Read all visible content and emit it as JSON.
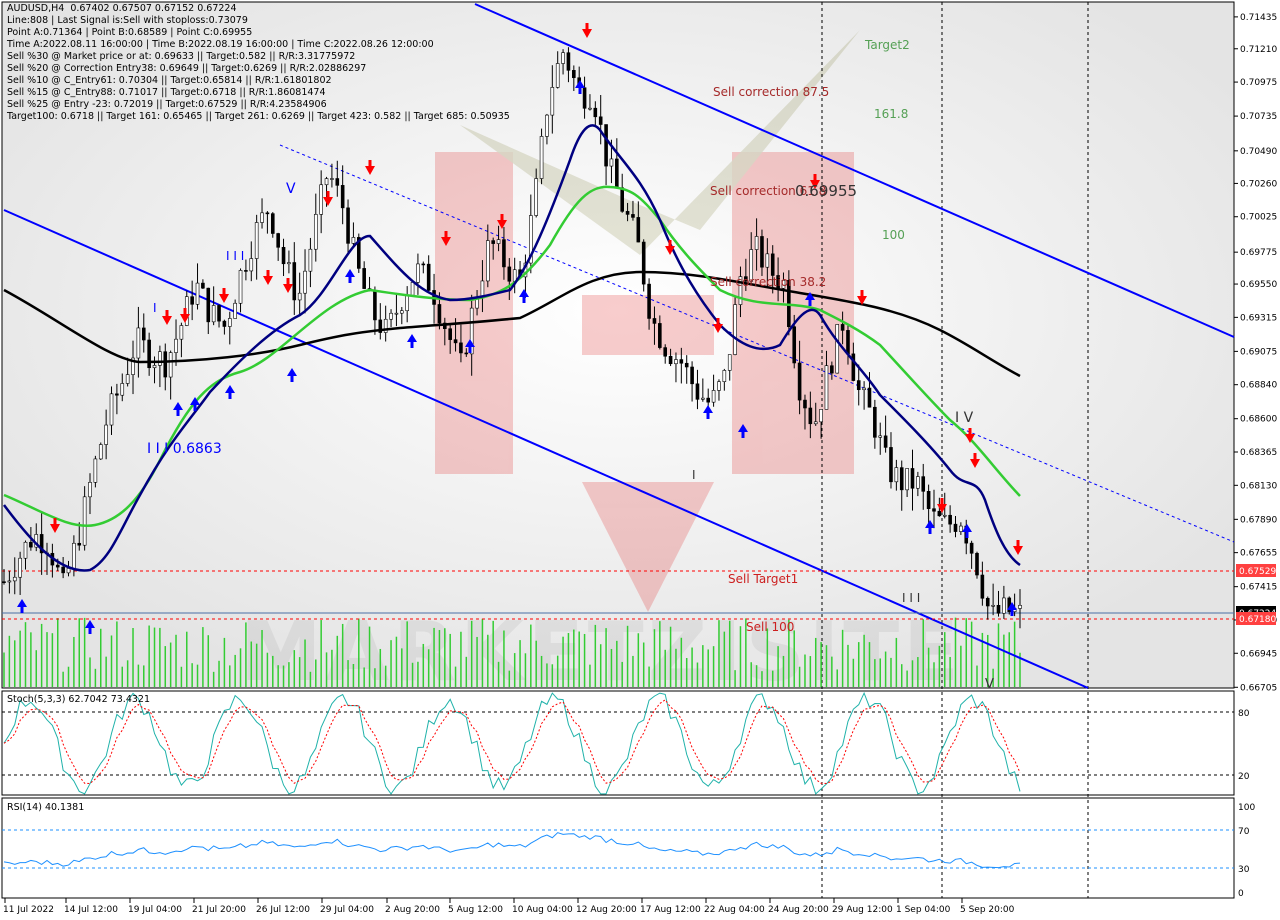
{
  "info_lines": [
    "AUDUSD,H4  0.67402 0.67507 0.67152 0.67224",
    "Line:808 | Last Signal is:Sell with stoploss:0.73079",
    "Point A:0.71364 | Point B:0.68589 | Point C:0.69955",
    "Time A:2022.08.11 16:00:00 | Time B:2022.08.19 16:00:00 | Time C:2022.08.26 12:00:00",
    "Sell %30 @ Market price or at: 0.69633 || Target:0.582 || R/R:3.31775972",
    "Sell %20 @ Correction Entry38: 0.69649 || Target:0.6269 || R/R:2.02886297",
    "Sell %10 @ C_Entry61: 0.70304 || Target:0.65814 || R/R:1.61801802",
    "Sell %15 @ C_Entry88: 0.71017 || Target:0.6718 || R/R:1.86081474",
    "Sell %25 @ Entry -23: 0.72019 || Target:0.67529 || R/R:4.23584906",
    "Target100: 0.6718 || Target 161: 0.65465 || Target 261: 0.6269 || Target 423: 0.582 || Target 685: 0.50935"
  ],
  "annotations": {
    "target2": "Target2",
    "fib_161": "161.8",
    "fib_100": "100",
    "sell_corr_875": "Sell correction 87.5",
    "sell_corr_618": "Sell correction 61.8",
    "point_c_value": "0.69955",
    "sell_corr_382": "Sell correction 38.2",
    "sell_target1": "Sell Target1",
    "sell_100": "Sell 100",
    "wave_v_top": "V",
    "wave_iii": "I I I",
    "wave_i": "I",
    "wave_iii_value": "I I I 0.6863",
    "wave_iv": "I V",
    "wave_i_low": "I",
    "wave_iii_low": "I I I",
    "wave_v_low": "V"
  },
  "stoch_label": "Stoch(5,3,3) 62.7042 73.4321",
  "rsi_label": "RSI(14) 40.1381",
  "current_price": "0.67224",
  "colors": {
    "channel": "#0000ff",
    "ma_black": "#000000",
    "ma_green": "#33cc33",
    "ma_navy": "#000080",
    "sell_arrow": "#ff0000",
    "buy_arrow": "#0000ff",
    "volume": "#33cc33",
    "target_line": "#ff0000",
    "stoch_main": "#20b2aa",
    "stoch_signal": "#ff0000",
    "rsi": "#1e90ff"
  },
  "chart_data": {
    "type": "candlestick",
    "symbol": "AUDUSD,H4",
    "ohlc_last": {
      "open": 0.67402,
      "high": 0.67507,
      "low": 0.67152,
      "close": 0.67224
    },
    "price_axis": {
      "ylim": [
        0.667,
        0.7154
      ],
      "ticks": [
        "0.71435",
        "0.71210",
        "0.70975",
        "0.70735",
        "0.70490",
        "0.70260",
        "0.70025",
        "0.69775",
        "0.69550",
        "0.69315",
        "0.69075",
        "0.68840",
        "0.68600",
        "0.68365",
        "0.68130",
        "0.67890",
        "0.67655",
        "0.67415",
        "0.67180",
        "0.66945",
        "0.66705"
      ]
    },
    "time_axis": {
      "ticks": [
        "11 Jul 2022",
        "14 Jul 12:00",
        "19 Jul 04:00",
        "21 Jul 20:00",
        "26 Jul 12:00",
        "29 Jul 04:00",
        "2 Aug 20:00",
        "5 Aug 12:00",
        "10 Aug 04:00",
        "12 Aug 20:00",
        "17 Aug 12:00",
        "22 Aug 04:00",
        "24 Aug 20:00",
        "29 Aug 12:00",
        "1 Sep 04:00",
        "5 Sep 20:00"
      ]
    },
    "price_path": [
      0.6745,
      0.6762,
      0.6778,
      0.6773,
      0.674,
      0.6775,
      0.682,
      0.686,
      0.6885,
      0.6915,
      0.6905,
      0.69,
      0.6925,
      0.6955,
      0.6935,
      0.6925,
      0.696,
      0.699,
      0.701,
      0.697,
      0.6945,
      0.699,
      0.7035,
      0.701,
      0.6965,
      0.6935,
      0.692,
      0.6945,
      0.6965,
      0.6955,
      0.6925,
      0.6895,
      0.6945,
      0.6985,
      0.697,
      0.6955,
      0.701,
      0.709,
      0.712,
      0.709,
      0.709,
      0.704,
      0.701,
      0.6985,
      0.693,
      0.691,
      0.69,
      0.688,
      0.687,
      0.689,
      0.696,
      0.698,
      0.6965,
      0.6955,
      0.6885,
      0.6855,
      0.6895,
      0.693,
      0.688,
      0.686,
      0.6825,
      0.6815,
      0.6815,
      0.679,
      0.6785,
      0.679,
      0.676,
      0.672,
      0.6725,
      0.6722
    ],
    "levels": [
      {
        "name": "Sell Target1",
        "value": 0.67529
      },
      {
        "name": "Sell 100",
        "value": 0.6718
      },
      {
        "name": "Current",
        "value": 0.67224
      }
    ],
    "stochastic": {
      "main": 62.7042,
      "signal": 73.4321,
      "levels": [
        80,
        20
      ],
      "axis": [
        "80",
        "20"
      ]
    },
    "rsi": {
      "value": 40.1381,
      "levels": [
        70,
        30
      ],
      "axis": [
        "100",
        "70",
        "30",
        "0"
      ]
    }
  }
}
